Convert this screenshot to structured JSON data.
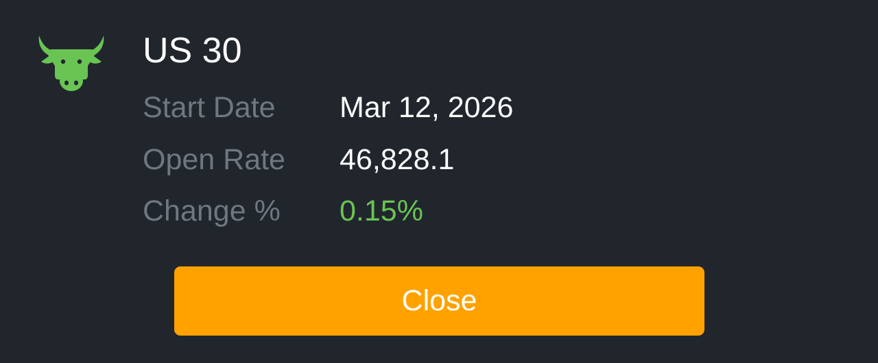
{
  "instrument": {
    "title": "US 30",
    "icon": "bull-icon",
    "icon_color": "#6ac454"
  },
  "details": {
    "start_date_label": "Start Date",
    "start_date_value": "Mar 12, 2026",
    "open_rate_label": "Open Rate",
    "open_rate_value": "46,828.1",
    "change_label": "Change %",
    "change_value": "0.15%",
    "change_color": "#6ac454"
  },
  "actions": {
    "close_label": "Close",
    "close_color": "#ffa200"
  },
  "colors": {
    "background": "#21262d",
    "label": "#6f7780",
    "value": "#ffffff"
  }
}
